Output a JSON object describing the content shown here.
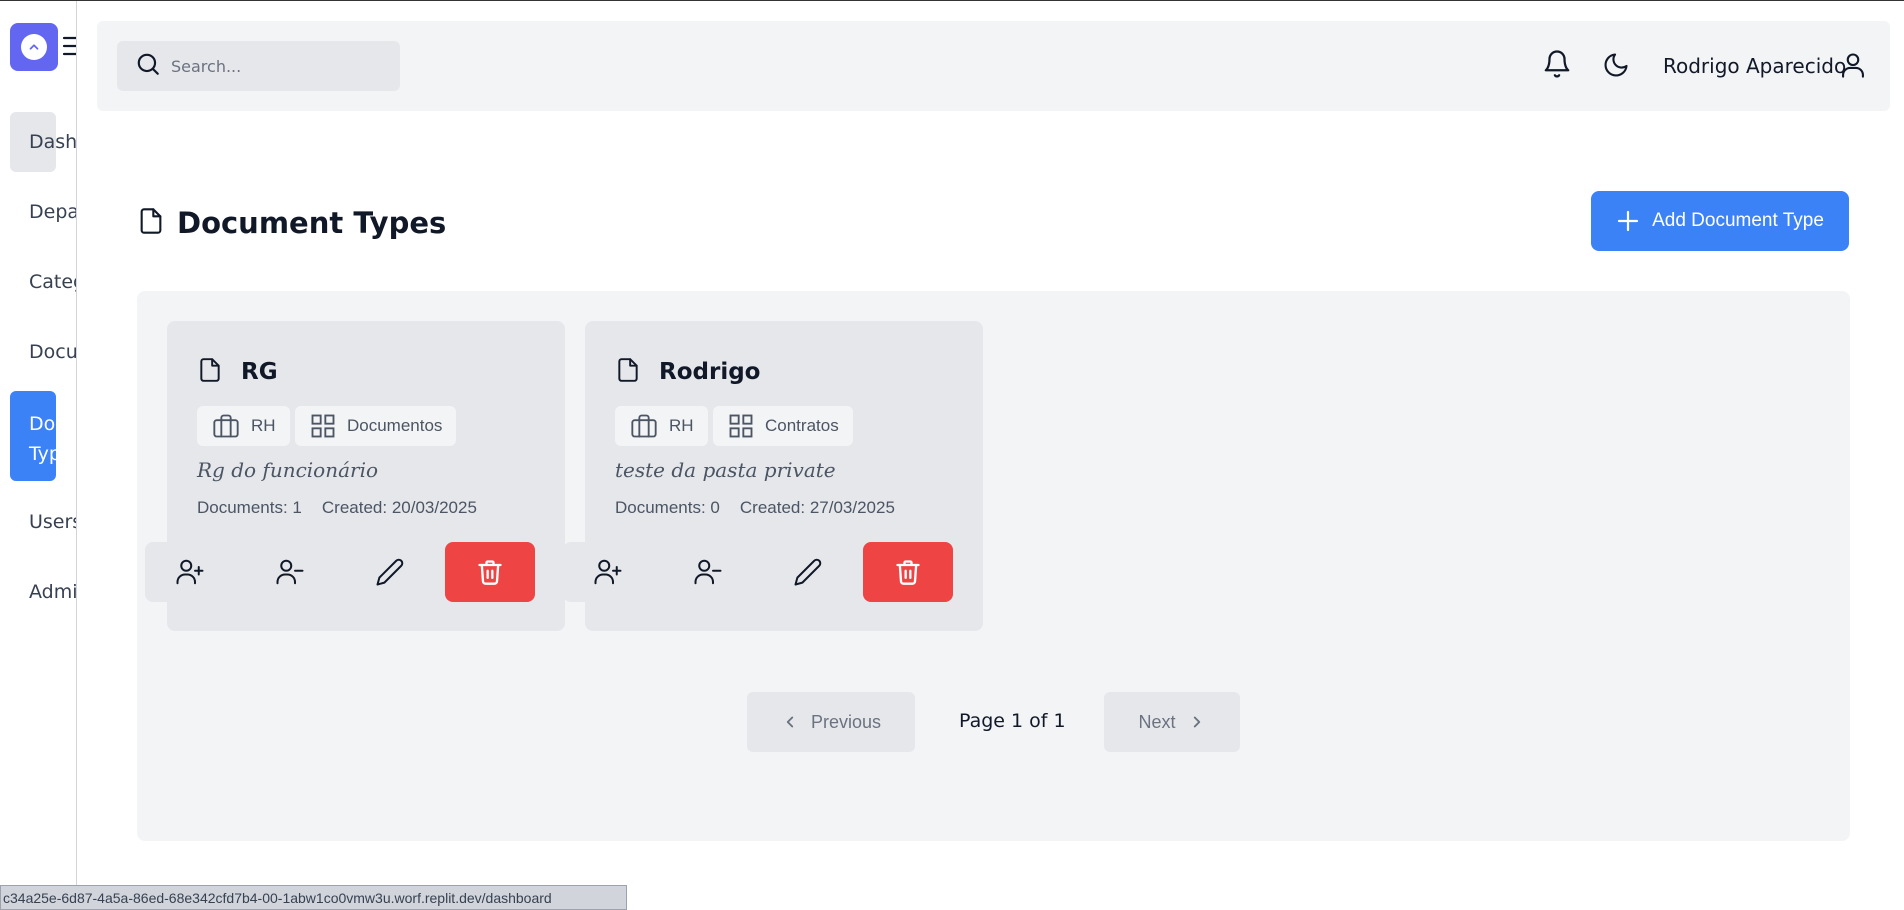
{
  "sidebar": {
    "items": [
      {
        "label": "Dashboard"
      },
      {
        "label": "Departments"
      },
      {
        "label": "Categories"
      },
      {
        "label": "Documents"
      },
      {
        "label": "Document Types"
      },
      {
        "label": "Users"
      },
      {
        "label": "Administrators"
      }
    ],
    "active_index": 4
  },
  "header": {
    "search_placeholder": "Search...",
    "user_name": "Rodrigo Aparecido"
  },
  "page": {
    "title": "Document Types",
    "add_button_label": "Add Document Type"
  },
  "cards": [
    {
      "title": "RG",
      "department": "RH",
      "category": "Documentos",
      "description": "Rg do funcionário",
      "documents": "Documents: 1",
      "created": "Created: 20/03/2025"
    },
    {
      "title": "Rodrigo",
      "department": "RH",
      "category": "Contratos",
      "description": "teste da pasta private",
      "documents": "Documents: 0",
      "created": "Created: 27/03/2025"
    }
  ],
  "pagination": {
    "previous_label": "Previous",
    "page_text": "Page 1 of 1",
    "next_label": "Next"
  },
  "status_url": "c34a25e-6d87-4a5a-86ed-68e342cfd7b4-00-1abw1co0vmw3u.worf.replit.dev/dashboard",
  "colors": {
    "accent": "#3b82f6",
    "logo": "#6366f1",
    "danger": "#ef4444"
  },
  "icons": {
    "logo": "chevron-up-circle-icon",
    "menu": "hamburger-icon",
    "search": "search-icon",
    "notifications": "bell-icon",
    "theme": "moon-icon",
    "user": "user-icon",
    "page": "file-icon",
    "add": "plus-icon",
    "department": "briefcase-icon",
    "category": "grid-icon",
    "add_user": "user-plus-icon",
    "remove_user": "user-minus-icon",
    "edit": "pencil-icon",
    "delete": "trash-icon"
  }
}
